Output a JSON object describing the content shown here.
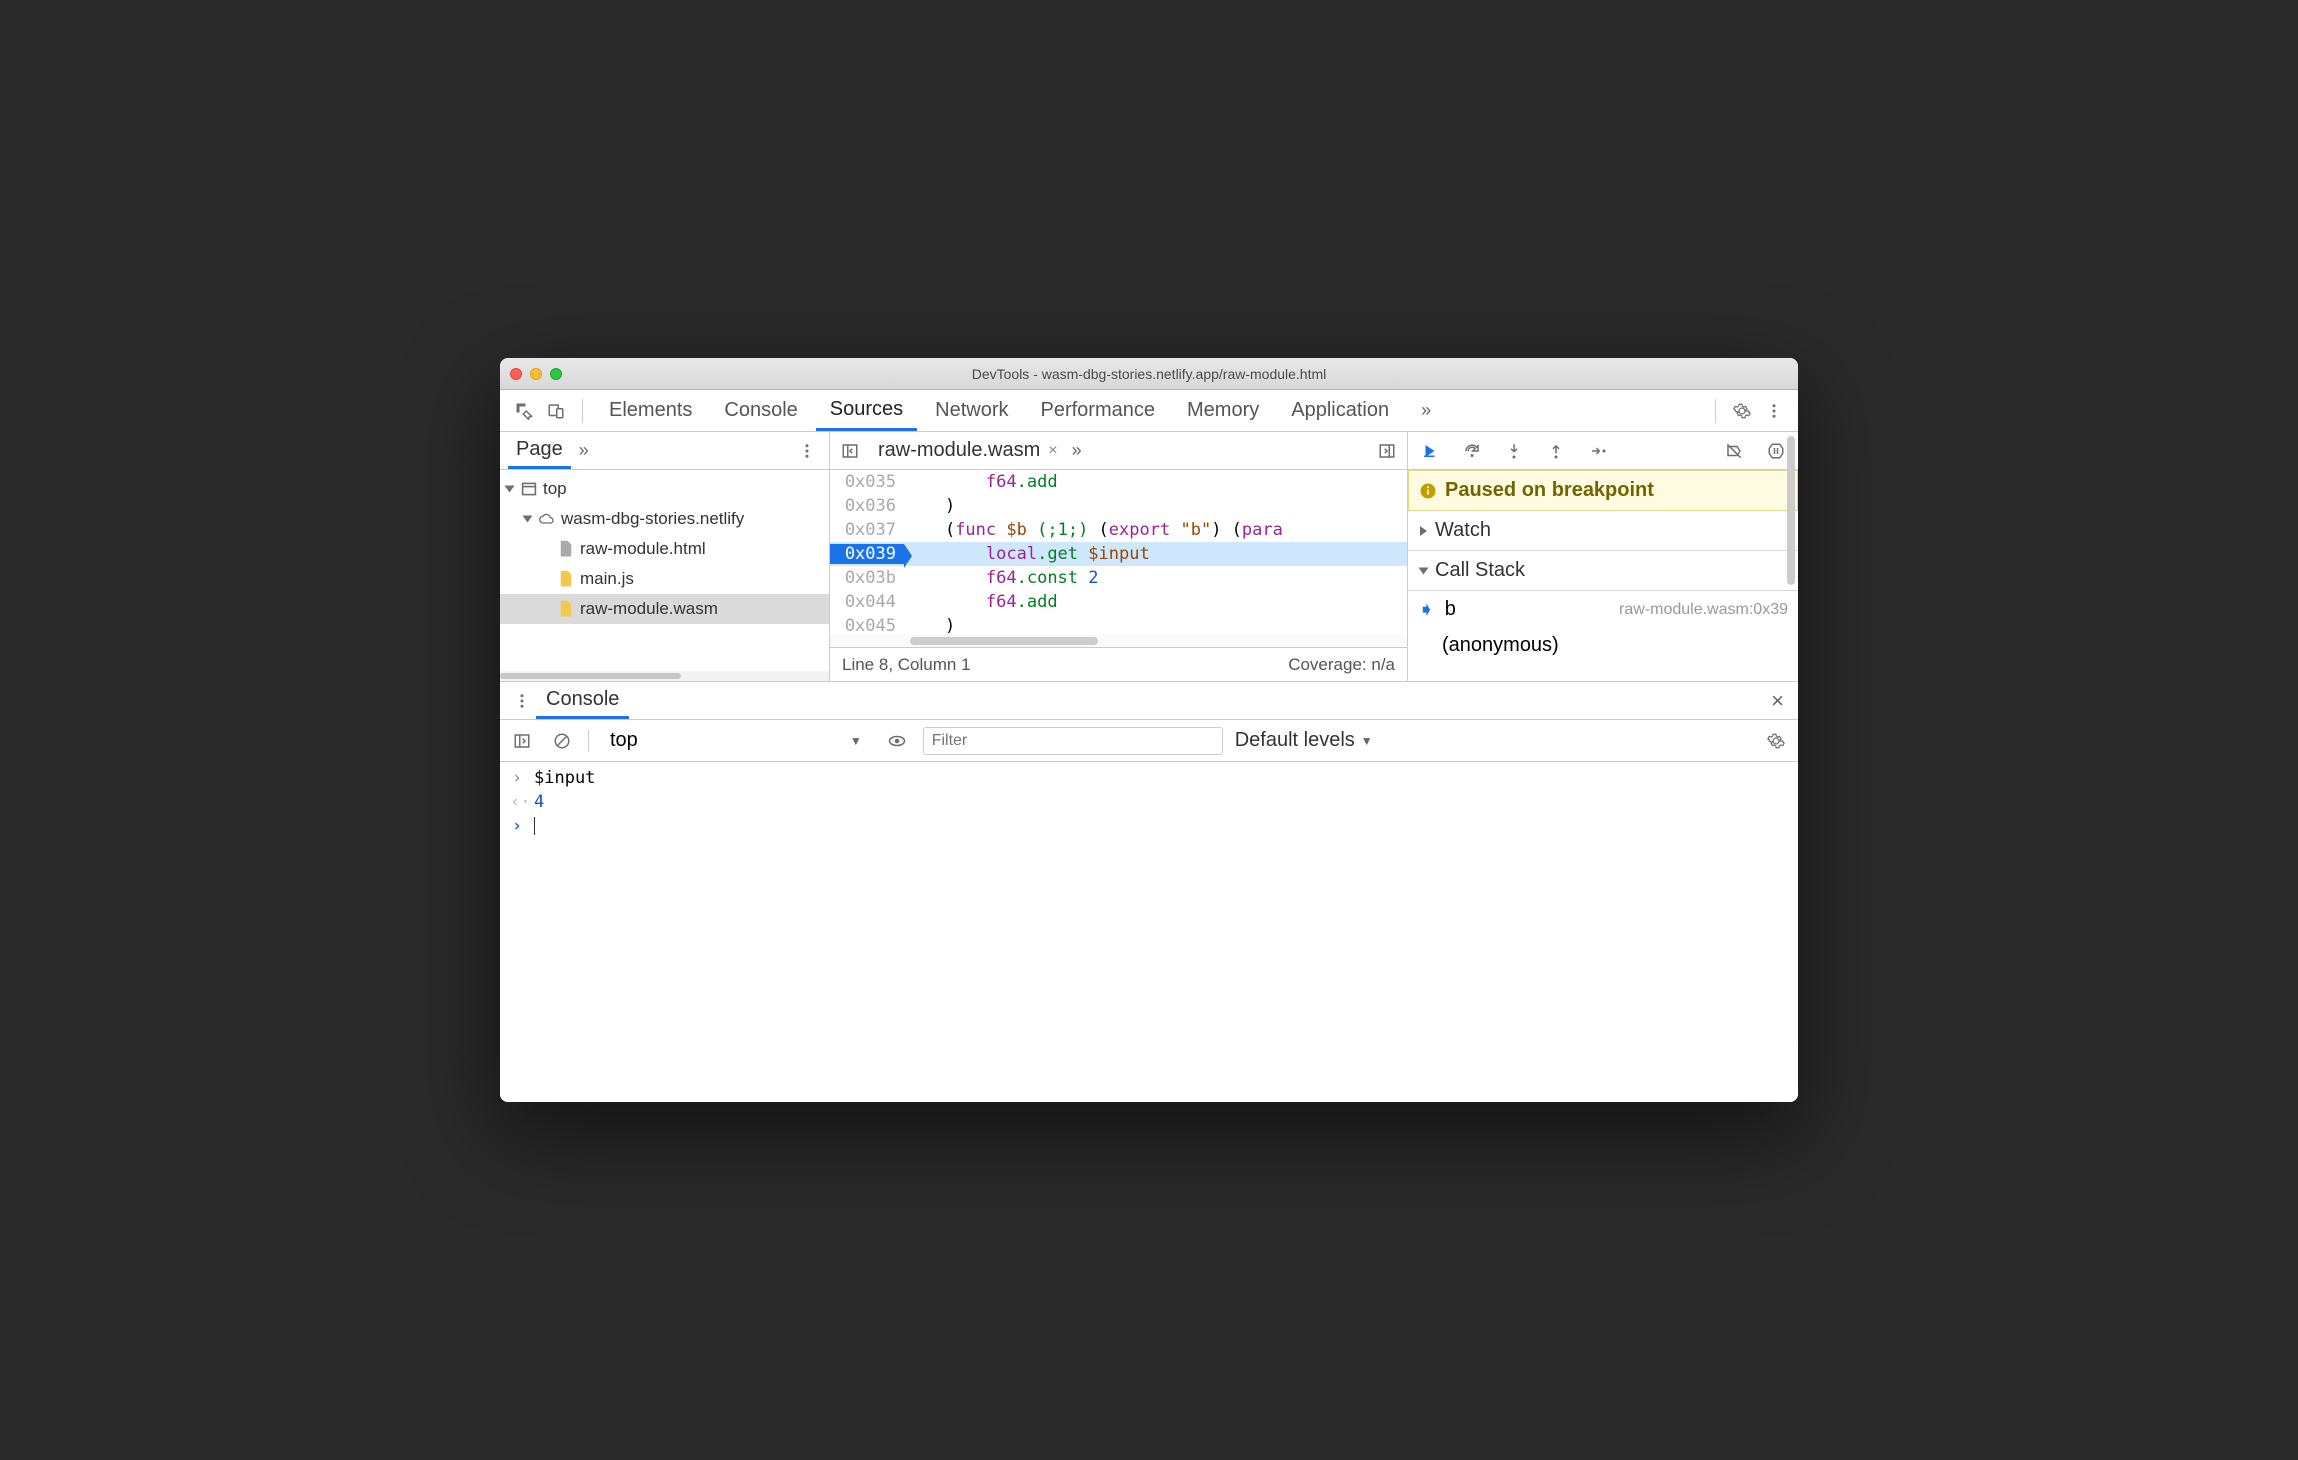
{
  "window": {
    "title": "DevTools - wasm-dbg-stories.netlify.app/raw-module.html"
  },
  "main_tabs": [
    "Elements",
    "Console",
    "Sources",
    "Network",
    "Performance",
    "Memory",
    "Application"
  ],
  "main_active": "Sources",
  "left": {
    "tab": "Page",
    "tree": {
      "top": "top",
      "domain": "wasm-dbg-stories.netlify",
      "files": [
        "raw-module.html",
        "main.js",
        "raw-module.wasm"
      ],
      "selected": "raw-module.wasm"
    }
  },
  "editor": {
    "tab": "raw-module.wasm",
    "lines": [
      {
        "addr": "0x035",
        "html": "        <span class='k-purple'>f64</span><span class='k-green'>.add</span>"
      },
      {
        "addr": "0x036",
        "html": "    )"
      },
      {
        "addr": "0x037",
        "html": "    (<span class='k-purple'>func</span> <span class='k-brown'>$b</span> <span class='k-green'>(;1;)</span> (<span class='k-purple'>export</span> <span class='k-brown'>\"b\"</span>) (<span class='k-purple'>para</span>"
      },
      {
        "addr": "0x039",
        "html": "        <span class='k-purple'>local</span><span class='k-green'>.get</span> <span class='k-brown'>$input</span>",
        "hl": true
      },
      {
        "addr": "0x03b",
        "html": "        <span class='k-purple'>f64</span><span class='k-green'>.const</span> <span class='k-blue'>2</span>"
      },
      {
        "addr": "0x044",
        "html": "        <span class='k-purple'>f64</span><span class='k-green'>.add</span>"
      },
      {
        "addr": "0x045",
        "html": "    )"
      }
    ],
    "status_left": "Line 8, Column 1",
    "status_right": "Coverage: n/a"
  },
  "debug": {
    "paused": "Paused on breakpoint",
    "watch_label": "Watch",
    "callstack_label": "Call Stack",
    "frames": [
      {
        "name": "b",
        "loc": "raw-module.wasm:0x39",
        "current": true
      },
      {
        "name": "(anonymous)",
        "loc": ""
      }
    ]
  },
  "drawer": {
    "tab": "Console",
    "context": "top",
    "filter_placeholder": "Filter",
    "levels": "Default levels",
    "rows": [
      {
        "dir": "in",
        "text": "$input"
      },
      {
        "dir": "out",
        "text": "4",
        "num": true
      }
    ]
  }
}
